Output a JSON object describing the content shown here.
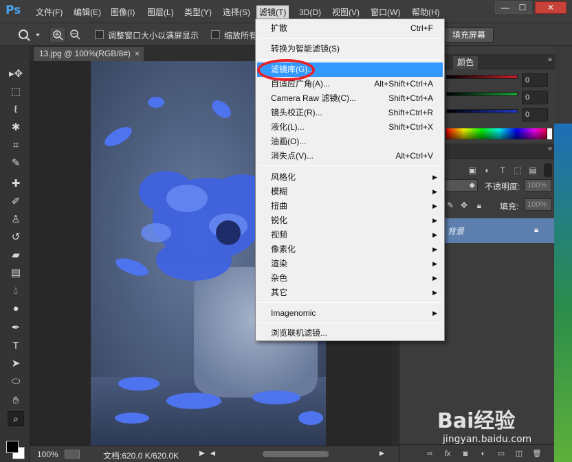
{
  "app": {
    "logo": "Ps"
  },
  "menubar": {
    "items": [
      "文件(F)",
      "编辑(E)",
      "图像(I)",
      "图层(L)",
      "类型(Y)",
      "选择(S)",
      "滤镜(T)",
      "3D(D)",
      "视图(V)",
      "窗口(W)",
      "帮助(H)"
    ],
    "active_index": 6
  },
  "window_controls": {
    "minimize": "—",
    "maximize": "☐",
    "close": "✕"
  },
  "options_bar": {
    "checkbox1_label": "调整窗口大小以满屏显示",
    "checkbox2_label": "缩放所有",
    "fill_screen_button": "填充屏幕"
  },
  "document": {
    "tab_title": "13.jpg @ 100%(RGB/8#)",
    "tab_close": "×"
  },
  "statusbar": {
    "zoom": "100%",
    "doc_info": "文档:620.0 K/620.0K"
  },
  "color_panel": {
    "tab_label": "颜色",
    "values": [
      "0",
      "0",
      "0"
    ],
    "colors": {
      "red": "#c8202a",
      "green": "#1ea23a",
      "blue": "#2038c8"
    }
  },
  "layers_panel": {
    "opacity_label": "不透明度:",
    "opacity_value": "100%",
    "fill_label": "填充:",
    "fill_value": "100%",
    "layer_name": "背景"
  },
  "filter_menu": {
    "items": [
      {
        "label": "扩散",
        "shortcut": "Ctrl+F"
      },
      {
        "label": "转换为智能滤镜(S)",
        "shortcut": ""
      },
      {
        "label": "滤镜库(G)...",
        "shortcut": "",
        "highlighted": true
      },
      {
        "label": "自适应广角(A)...",
        "shortcut": "Alt+Shift+Ctrl+A"
      },
      {
        "label": "Camera Raw 滤镜(C)...",
        "shortcut": "Shift+Ctrl+A"
      },
      {
        "label": "镜头校正(R)...",
        "shortcut": "Shift+Ctrl+R"
      },
      {
        "label": "液化(L)...",
        "shortcut": "Shift+Ctrl+X"
      },
      {
        "label": "油画(O)...",
        "shortcut": ""
      },
      {
        "label": "消失点(V)...",
        "shortcut": "Alt+Ctrl+V"
      },
      {
        "label": "风格化",
        "submenu": true
      },
      {
        "label": "模糊",
        "submenu": true
      },
      {
        "label": "扭曲",
        "submenu": true
      },
      {
        "label": "锐化",
        "submenu": true
      },
      {
        "label": "视频",
        "submenu": true
      },
      {
        "label": "像素化",
        "submenu": true
      },
      {
        "label": "渲染",
        "submenu": true
      },
      {
        "label": "杂色",
        "submenu": true
      },
      {
        "label": "其它",
        "submenu": true
      },
      {
        "label": "Imagenomic",
        "submenu": true
      },
      {
        "label": "浏览联机滤镜...",
        "shortcut": ""
      }
    ]
  },
  "watermark": {
    "brand": "Bai经验",
    "url": "jingyan.baidu.com"
  }
}
